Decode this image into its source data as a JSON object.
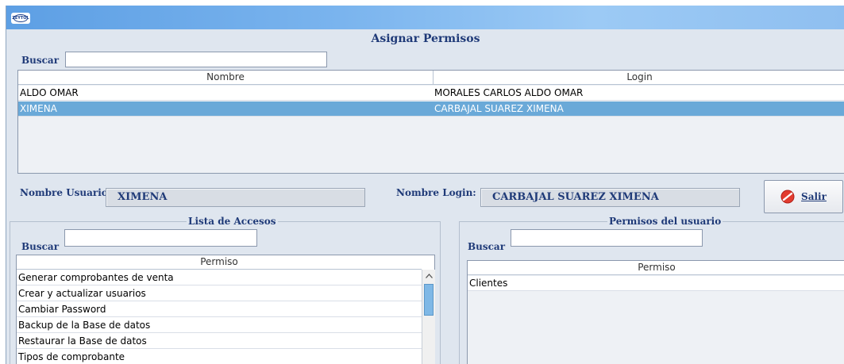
{
  "window": {
    "app_icon_text": "ZEYTOL"
  },
  "form_title": "Asignar Permisos",
  "user_search": {
    "label": "Buscar",
    "value": ""
  },
  "users_grid": {
    "columns": [
      "Nombre",
      "Login"
    ],
    "rows": [
      {
        "nombre": "ALDO OMAR",
        "login": "MORALES CARLOS ALDO OMAR",
        "selected": false
      },
      {
        "nombre": "XIMENA",
        "login": "CARBAJAL SUAREZ XIMENA",
        "selected": true
      }
    ]
  },
  "details": {
    "nombre_usuario_label": "Nombre Usuario:",
    "nombre_usuario_value": "XIMENA",
    "nombre_login_label": "Nombre Login:",
    "nombre_login_value": "CARBAJAL SUAREZ XIMENA"
  },
  "salir_button": {
    "label": "Salir",
    "icon": "no-entry-icon",
    "color": "#e23b2e"
  },
  "lista_accesos": {
    "title": "Lista de Accesos",
    "search_label": "Buscar",
    "search_value": "",
    "column": "Permiso",
    "items": [
      "Generar comprobantes de venta",
      "Crear y actualizar usuarios",
      "Cambiar Password",
      "Backup de la Base de datos",
      "Restaurar la Base de datos",
      "Tipos de comprobante"
    ]
  },
  "permisos_usuario": {
    "title": "Permisos del usuario",
    "search_label": "Buscar",
    "search_value": "",
    "column": "Permiso",
    "items": [
      "Clientes"
    ]
  },
  "colors": {
    "selection": "#6aa9d8",
    "label_text": "#1f3a78",
    "form_bg": "#dfe6ef"
  }
}
